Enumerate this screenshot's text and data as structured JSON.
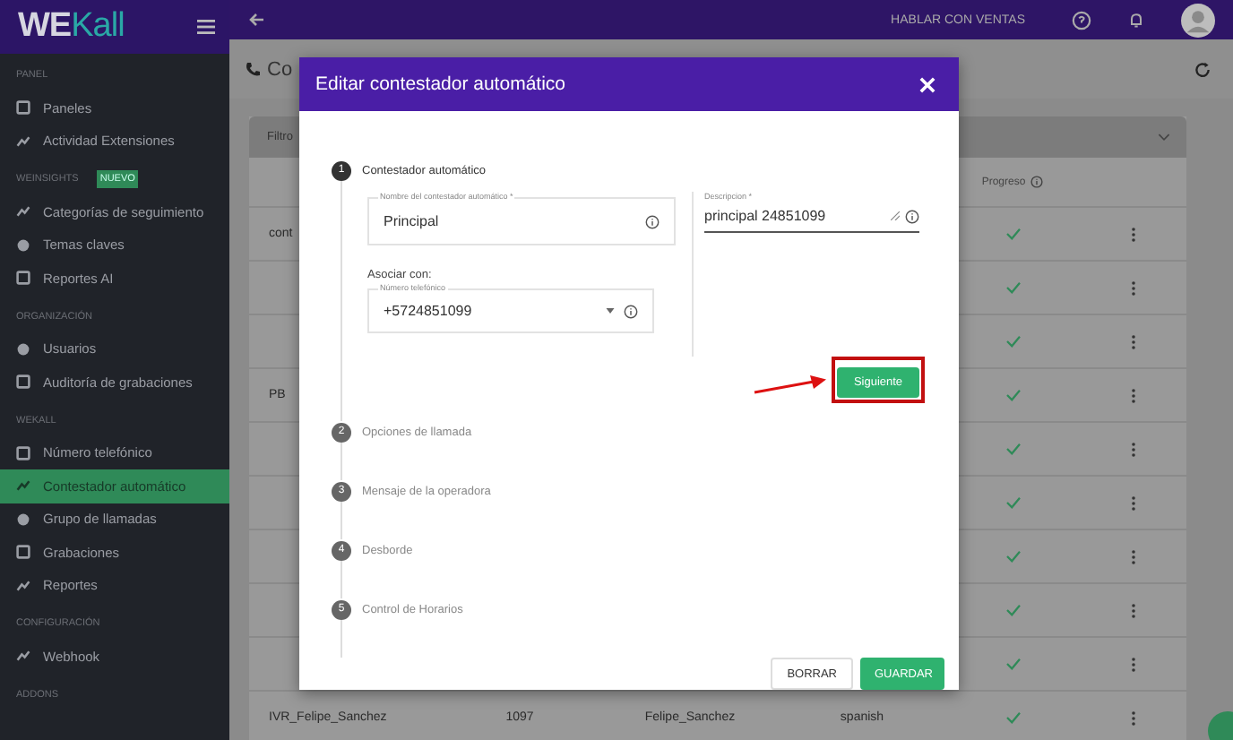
{
  "sidebar": {
    "logo": [
      "WE",
      "Kall"
    ],
    "sections": [
      {
        "title": "PANEL",
        "items": [
          {
            "label": "Paneles",
            "selected": false
          },
          {
            "label": "Actividad Extensiones",
            "selected": false
          }
        ]
      },
      {
        "title": "WEINSIGHTS",
        "badge": "NUEVO",
        "items": [
          {
            "label": "Categorías de seguimiento",
            "selected": false
          },
          {
            "label": "Temas claves",
            "selected": false
          },
          {
            "label": "Reportes AI",
            "selected": false
          }
        ]
      },
      {
        "title": "ORGANIZACIÓN",
        "items": [
          {
            "label": "Usuarios",
            "selected": false
          },
          {
            "label": "Auditoría de grabaciones",
            "selected": false
          }
        ]
      },
      {
        "title": "WEKALL",
        "items": [
          {
            "label": "Número telefónico",
            "selected": false
          },
          {
            "label": "Contestador automático",
            "selected": true
          },
          {
            "label": "Grupo de llamadas",
            "selected": false
          },
          {
            "label": "Grabaciones",
            "selected": false
          },
          {
            "label": "Reportes",
            "selected": false
          }
        ]
      },
      {
        "title": "CONFIGURACIÓN",
        "items": [
          {
            "label": "Webhook",
            "selected": false
          }
        ]
      },
      {
        "title": "ADDONS"
      }
    ]
  },
  "topbar": {
    "sales_link": "HABLAR CON VENTAS"
  },
  "page": {
    "title": "Co",
    "filter": "Filtro"
  },
  "table": {
    "progress_header": "Progreso",
    "rows": [
      {
        "column_1": "cont",
        "done": true
      },
      {
        "done": true
      },
      {
        "done": true
      },
      {
        "column_1": "PB",
        "done": true
      },
      {
        "done": true
      },
      {
        "done": true
      },
      {
        "done": true
      },
      {
        "done": true
      },
      {
        "done": true
      },
      {
        "column_1": "IVR_Felipe_Sanchez",
        "column_2": "1097",
        "column_3": "Felipe_Sanchez",
        "column_4": "spanish",
        "done": true
      }
    ]
  },
  "modal": {
    "title": "Editar contestador automático",
    "steps": [
      {
        "number": "1",
        "label": "Contestador automático",
        "active": true
      },
      {
        "number": "2",
        "label": "Opciones de llamada",
        "active": false
      },
      {
        "number": "3",
        "label": "Mensaje de la operadora",
        "active": false
      },
      {
        "number": "4",
        "label": "Desborde",
        "active": false
      },
      {
        "number": "5",
        "label": "Control de Horarios",
        "active": false
      }
    ],
    "name_field": {
      "label": "Nombre del contestador automático *",
      "value": "Principal"
    },
    "associate_label": "Asociar con:",
    "phone_field": {
      "label": "Número telefónico",
      "value": "+5724851099"
    },
    "description_field": {
      "label": "Descripcion *",
      "value": "principal 24851099"
    },
    "next_button": "Siguiente",
    "buttons": [
      "BORRAR",
      "GUARDAR"
    ]
  }
}
